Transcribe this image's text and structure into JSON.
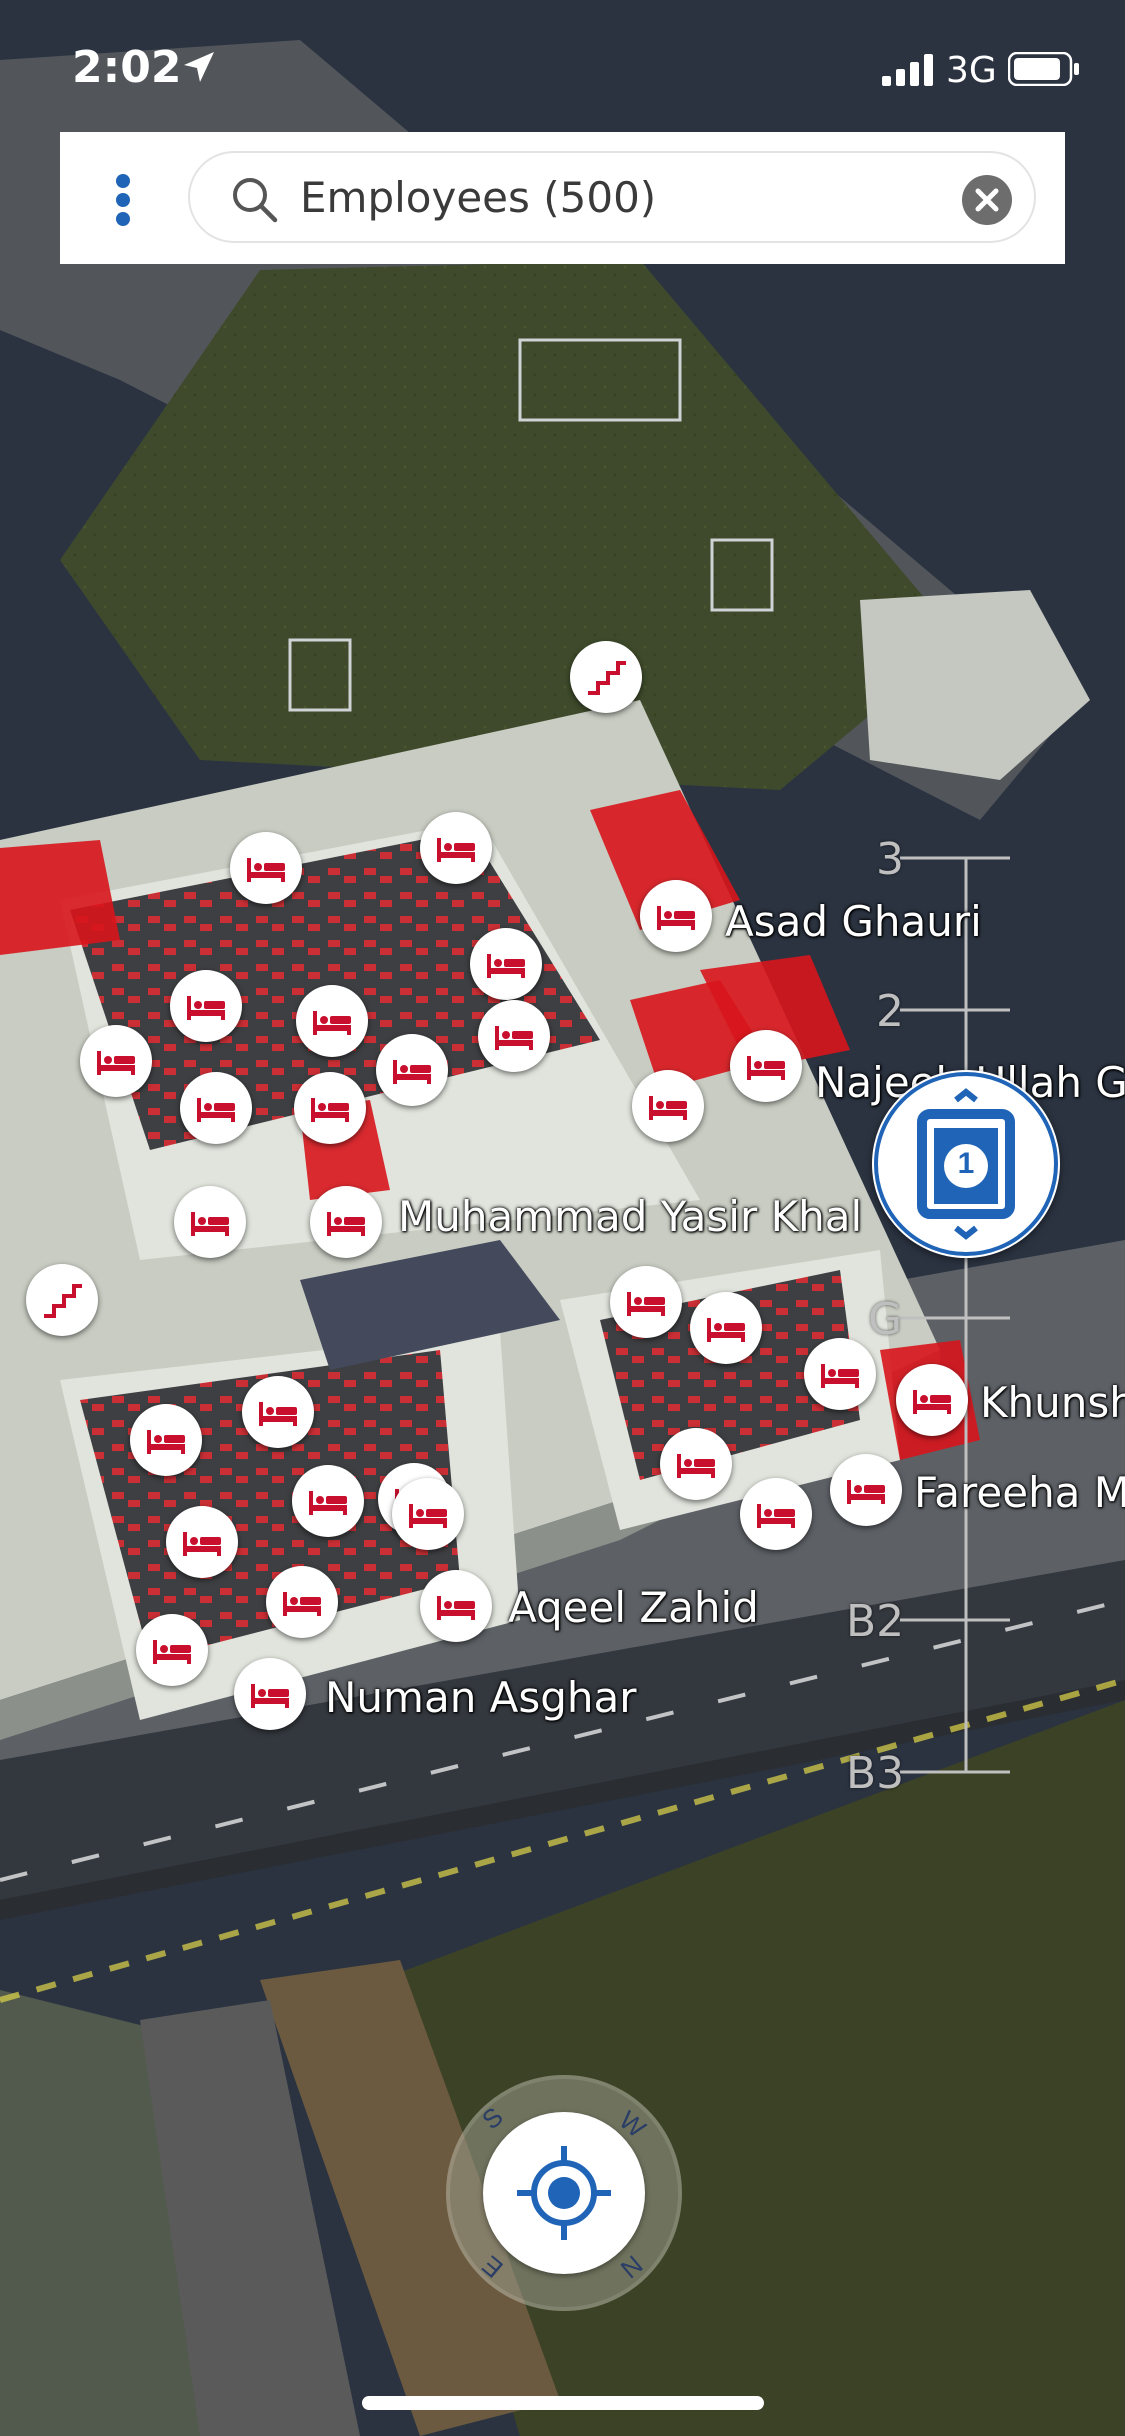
{
  "status_bar": {
    "time": "2:02",
    "network": "3G"
  },
  "search": {
    "value": "Employees (500)"
  },
  "people": [
    {
      "name": "Asad Ghauri"
    },
    {
      "name": "Najeeb Ullah G"
    },
    {
      "name": "Muhammad Yasir Khal"
    },
    {
      "name": "Khunsh"
    },
    {
      "name": "Fareeha M"
    },
    {
      "name": "Aqeel Zahid"
    },
    {
      "name": "Numan Asghar"
    }
  ],
  "floor_selector": {
    "levels": [
      "3",
      "2",
      "G",
      "B2",
      "B3"
    ],
    "current_floor": "1"
  },
  "compass": {
    "directions": [
      "S",
      "W",
      "N",
      "E"
    ]
  },
  "colors": {
    "accent_blue": "#1f64b7",
    "desk_red": "#d8151c",
    "marker_red": "#c8102e",
    "grass": "#3f4a2c",
    "background": "#2b3341"
  },
  "icons": {
    "menu": "vertical-dots-icon",
    "search": "magnifier-icon",
    "clear": "close-icon",
    "employee_marker": "bed-icon",
    "stairs": "stairs-icon",
    "elevator": "elevator-icon",
    "locate": "crosshair-icon"
  }
}
